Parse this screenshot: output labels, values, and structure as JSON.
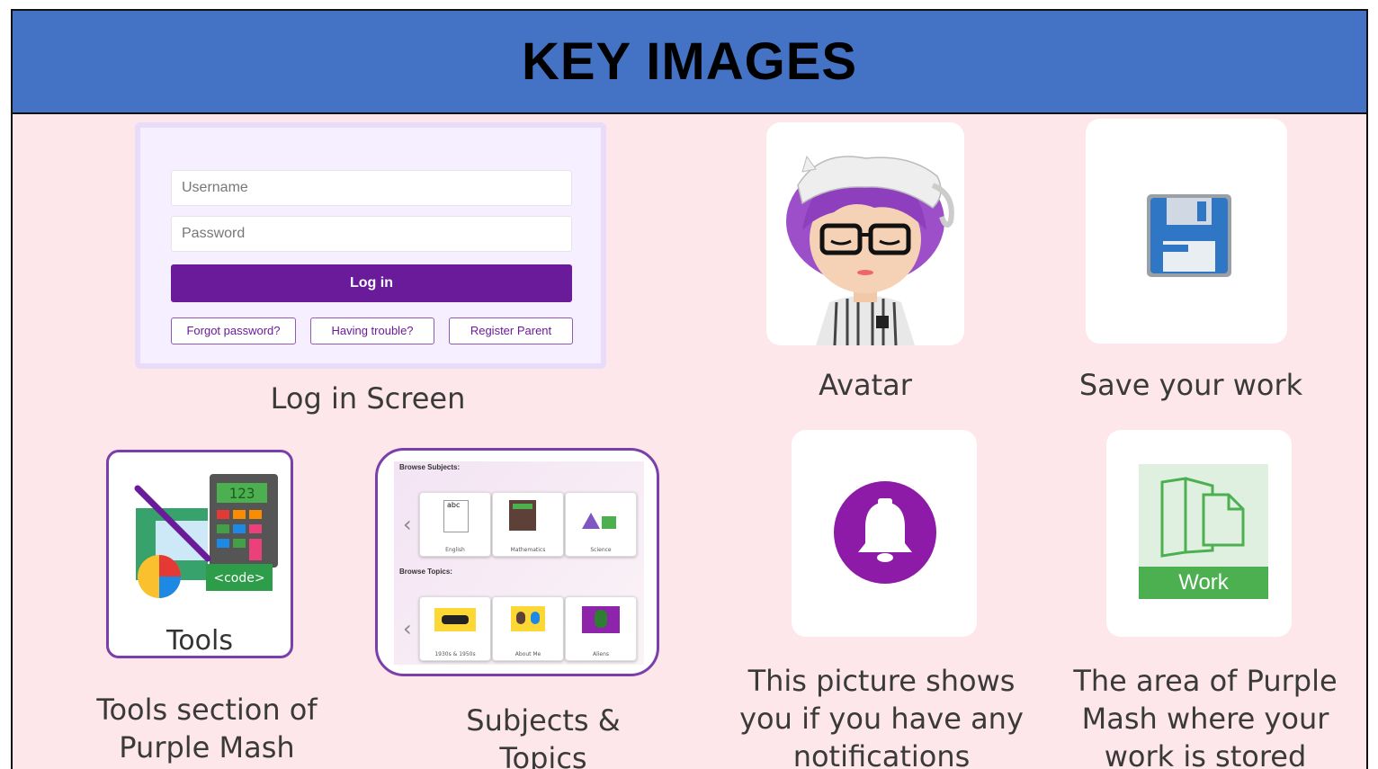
{
  "header": {
    "title": "KEY IMAGES"
  },
  "login": {
    "username_placeholder": "Username",
    "password_placeholder": "Password",
    "login_label": "Log in",
    "forgot_label": "Forgot password?",
    "trouble_label": "Having trouble?",
    "register_label": "Register Parent",
    "caption": "Log in Screen"
  },
  "avatar": {
    "caption": "Avatar"
  },
  "save": {
    "caption": "Save your work"
  },
  "tools": {
    "label": "Tools",
    "code_label": "<code>",
    "calc_display": "123",
    "caption_line1": "Tools section of",
    "caption_line2": "Purple Mash"
  },
  "subjects": {
    "browse_subjects": "Browse Subjects:",
    "browse_topics": "Browse Topics:",
    "subject_tiles": [
      "English",
      "Mathematics",
      "Science"
    ],
    "topic_tiles": [
      "1930s & 1950s",
      "About Me",
      "Aliens"
    ],
    "english_icon_text": "abc",
    "caption_line1": "Subjects &",
    "caption_line2": "Topics"
  },
  "notifications": {
    "caption_line1": "This picture shows",
    "caption_line2": "you if you have any",
    "caption_line3": "notifications"
  },
  "work": {
    "label": "Work",
    "caption_line1": "The area of Purple",
    "caption_line2": "Mash where your",
    "caption_line3": "work is stored"
  },
  "colors": {
    "header_bg": "#4472c4",
    "page_bg": "#fde7ea",
    "purple": "#6a1b9a",
    "work_green": "#4caf50"
  }
}
